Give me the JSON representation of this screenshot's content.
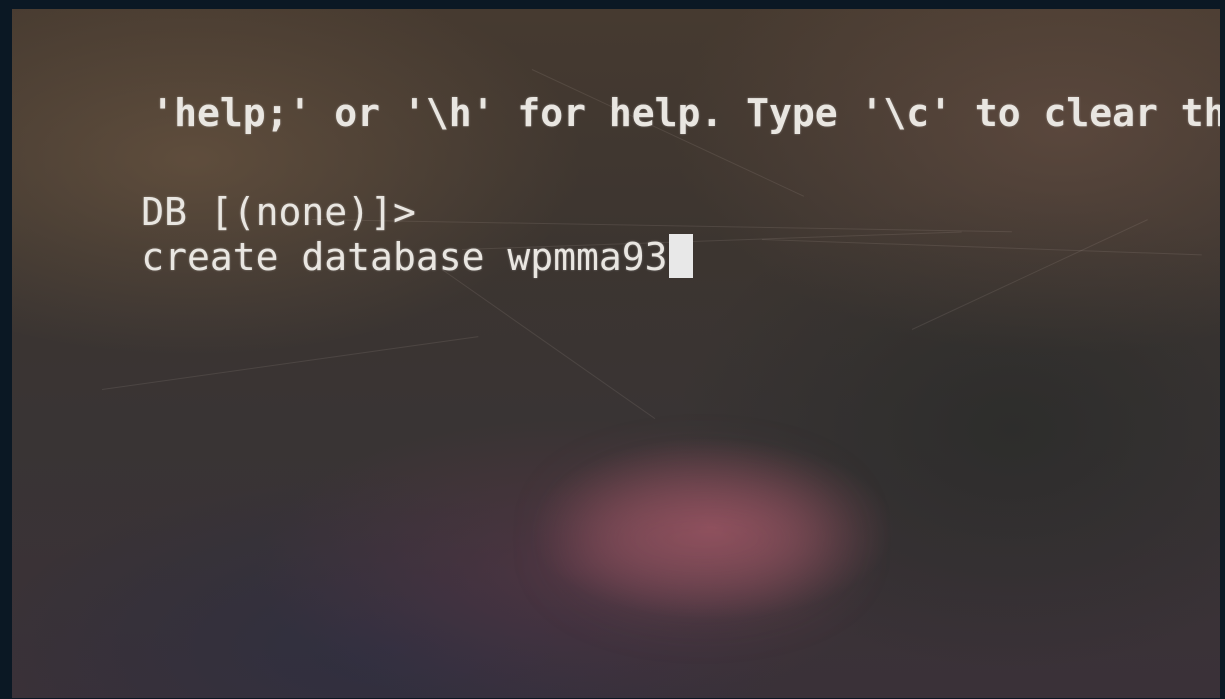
{
  "terminal": {
    "line_help": "'help;' or '\\h' for help. Type '\\c' to clear the c",
    "prompt": "DB [(none)]>",
    "command": "create database wpmma93"
  },
  "colors": {
    "text": "#e9e6e1",
    "cursor": "#e8e8e8",
    "bezel": "#0b1824"
  }
}
